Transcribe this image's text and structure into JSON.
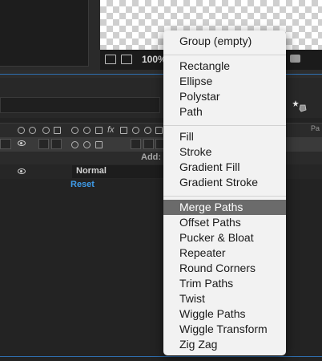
{
  "viewer": {
    "zoom": "100%"
  },
  "timeline": {
    "add_label": "Add:",
    "blend_mode": "Normal",
    "reset_label": "Reset",
    "column_fx": "fx",
    "column_pa": "Pa"
  },
  "menu": {
    "groups": [
      [
        "Group (empty)"
      ],
      [
        "Rectangle",
        "Ellipse",
        "Polystar",
        "Path"
      ],
      [
        "Fill",
        "Stroke",
        "Gradient Fill",
        "Gradient Stroke"
      ],
      [
        "Merge Paths",
        "Offset Paths",
        "Pucker & Bloat",
        "Repeater",
        "Round Corners",
        "Trim Paths",
        "Twist",
        "Wiggle Paths",
        "Wiggle Transform",
        "Zig Zag"
      ]
    ],
    "selected": "Merge Paths"
  },
  "colors": {
    "menu_bg": "#f2f2f2",
    "menu_highlight": "#6b6b6b",
    "reset_link": "#3f9be8",
    "accent_line": "#2f6fb0"
  }
}
